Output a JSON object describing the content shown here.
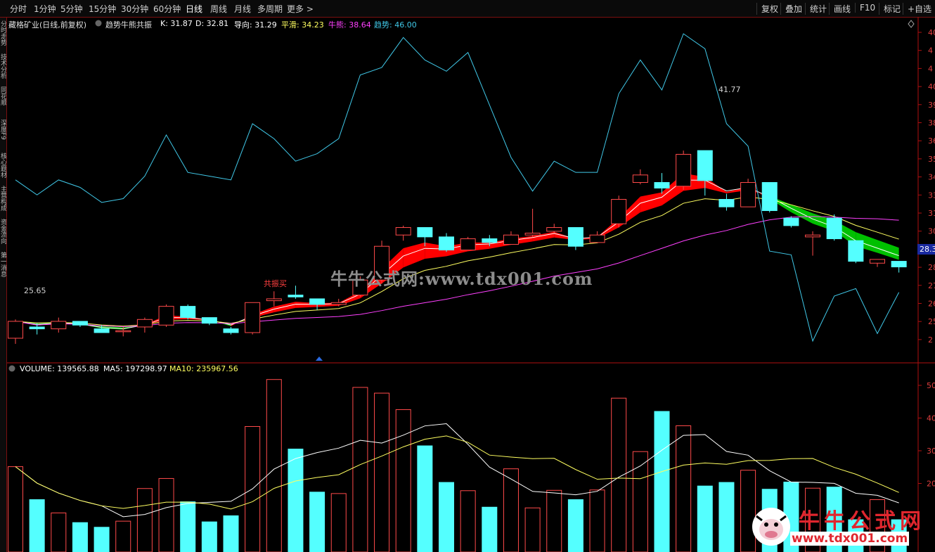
{
  "toolbar": {
    "periods": [
      "分时",
      "1分钟",
      "5分钟",
      "15分钟",
      "30分钟",
      "60分钟",
      "日线",
      "周线",
      "月线",
      "多周期",
      "更多 >"
    ],
    "active": "日线",
    "right": [
      "复权",
      "叠加",
      "统计",
      "画线",
      "F10",
      "标记",
      "+自选"
    ]
  },
  "sidebar": [
    "分时走势",
    "技术分析",
    "同花顺",
    "深度F9",
    "核心题材",
    "主营构成",
    "资金流向",
    "第一消息"
  ],
  "header": {
    "stock": "藏格矿业(日线,前复权)",
    "indicator": "趋势牛熊共振",
    "k": "K: 31.87",
    "d": "D: 32.81",
    "dx": "导向: 31.29",
    "ph": "平滑: 34.23",
    "nx": "牛熊: 38.64",
    "qs": "趋势: 46.00"
  },
  "volume_header": {
    "vol": "VOLUME: 139565.88",
    "ma5": "MA5: 197298.97",
    "ma10": "MA10: 235967.56"
  },
  "annotations": {
    "high": "41.77",
    "low": "25.65",
    "signal": "共振买"
  },
  "price_tag": "28.3",
  "axis_labels": {
    "price": [
      "40",
      "4",
      "4",
      "40",
      "39",
      "38",
      "36",
      "35",
      "34",
      "33",
      "31",
      "30",
      "29",
      "28",
      "27",
      "26",
      "25",
      "2"
    ],
    "volume": [
      "50",
      "40",
      "30",
      "20"
    ]
  },
  "watermarks": {
    "center": "牛牛公式网:www.tdx001.com",
    "logo_cn": "牛牛公式网",
    "logo_url": "www.tdx001.com"
  },
  "colors": {
    "up": "#ff4a4a",
    "down": "#54ffff",
    "ma_white": "#ffffff",
    "ma_yellow": "#ffff60",
    "ma_magenta": "#ff40ff",
    "ma_cyan": "#40c8e8",
    "band_red": "#ff0000",
    "band_green": "#00c000",
    "axis": "#b01010"
  },
  "chart_data": {
    "type": "candlestick",
    "candles": [
      {
        "o": 25.7,
        "h": 26.7,
        "l": 25.4,
        "c": 26.6
      },
      {
        "o": 26.3,
        "h": 26.5,
        "l": 25.9,
        "c": 26.2
      },
      {
        "o": 26.2,
        "h": 26.8,
        "l": 26.0,
        "c": 26.6
      },
      {
        "o": 26.6,
        "h": 26.6,
        "l": 26.3,
        "c": 26.4
      },
      {
        "o": 26.2,
        "h": 26.4,
        "l": 26.0,
        "c": 26.0
      },
      {
        "o": 26.1,
        "h": 26.3,
        "l": 25.8,
        "c": 26.1
      },
      {
        "o": 26.3,
        "h": 26.8,
        "l": 26.0,
        "c": 26.7
      },
      {
        "o": 26.4,
        "h": 27.5,
        "l": 26.3,
        "c": 27.4
      },
      {
        "o": 27.4,
        "h": 27.5,
        "l": 26.7,
        "c": 26.8
      },
      {
        "o": 26.8,
        "h": 26.8,
        "l": 26.4,
        "c": 26.5
      },
      {
        "o": 26.2,
        "h": 26.3,
        "l": 25.9,
        "c": 26.0
      },
      {
        "o": 26.0,
        "h": 27.6,
        "l": 25.9,
        "c": 27.6
      },
      {
        "o": 27.7,
        "h": 28.2,
        "l": 27.4,
        "c": 27.8
      },
      {
        "o": 28.0,
        "h": 28.5,
        "l": 27.8,
        "c": 27.9
      },
      {
        "o": 27.8,
        "h": 27.8,
        "l": 27.2,
        "c": 27.5
      },
      {
        "o": 27.5,
        "h": 27.8,
        "l": 27.4,
        "c": 27.6
      },
      {
        "o": 28.0,
        "h": 29.0,
        "l": 27.9,
        "c": 28.8
      },
      {
        "o": 28.8,
        "h": 30.9,
        "l": 28.6,
        "c": 30.6
      },
      {
        "o": 31.2,
        "h": 31.7,
        "l": 30.9,
        "c": 31.6
      },
      {
        "o": 31.6,
        "h": 31.6,
        "l": 30.6,
        "c": 31.1
      },
      {
        "o": 31.1,
        "h": 31.3,
        "l": 30.3,
        "c": 30.4
      },
      {
        "o": 30.4,
        "h": 31.1,
        "l": 30.4,
        "c": 31.0
      },
      {
        "o": 31.0,
        "h": 31.2,
        "l": 30.6,
        "c": 30.8
      },
      {
        "o": 30.7,
        "h": 31.4,
        "l": 30.7,
        "c": 31.2
      },
      {
        "o": 31.2,
        "h": 32.6,
        "l": 31.1,
        "c": 31.3
      },
      {
        "o": 31.4,
        "h": 31.8,
        "l": 31.3,
        "c": 31.6
      },
      {
        "o": 31.6,
        "h": 31.6,
        "l": 30.4,
        "c": 30.6
      },
      {
        "o": 30.8,
        "h": 31.4,
        "l": 30.8,
        "c": 31.2
      },
      {
        "o": 31.8,
        "h": 33.3,
        "l": 31.6,
        "c": 33.1
      },
      {
        "o": 34.0,
        "h": 34.7,
        "l": 33.9,
        "c": 34.4
      },
      {
        "o": 34.0,
        "h": 34.5,
        "l": 33.4,
        "c": 33.7
      },
      {
        "o": 33.8,
        "h": 35.7,
        "l": 33.6,
        "c": 35.5
      },
      {
        "o": 35.7,
        "h": 35.7,
        "l": 33.3,
        "c": 34.1
      },
      {
        "o": 33.1,
        "h": 33.4,
        "l": 32.5,
        "c": 32.7
      },
      {
        "o": 32.7,
        "h": 34.2,
        "l": 32.7,
        "c": 34.0
      },
      {
        "o": 34.0,
        "h": 34.0,
        "l": 32.4,
        "c": 32.5
      },
      {
        "o": 32.1,
        "h": 32.2,
        "l": 31.6,
        "c": 31.7
      },
      {
        "o": 31.1,
        "h": 31.4,
        "l": 30.1,
        "c": 31.2
      },
      {
        "o": 32.1,
        "h": 32.3,
        "l": 30.9,
        "c": 31.0
      },
      {
        "o": 30.9,
        "h": 30.9,
        "l": 29.7,
        "c": 29.8
      },
      {
        "o": 29.7,
        "h": 29.9,
        "l": 29.5,
        "c": 29.9
      },
      {
        "o": 29.8,
        "h": 29.8,
        "l": 29.2,
        "c": 29.5
      }
    ],
    "volume": [
      28.8,
      19.6,
      15.9,
      13.2,
      11.9,
      13.6,
      22.7,
      25.5,
      19.0,
      13.4,
      15.1,
      40.0,
      53.1,
      33.7,
      21.7,
      21.3,
      50.9,
      49.3,
      44.7,
      34.6,
      24.4,
      22.1,
      17.5,
      28.2,
      17.3,
      22.2,
      19.6,
      22.3,
      47.9,
      33.0,
      44.2,
      40.2,
      23.4,
      24.4,
      27.8,
      22.5,
      24.5,
      22.8,
      23.1,
      14.0,
      19.6,
      14.0
    ],
    "price_axis": {
      "min": 24.8,
      "max": 42.3
    },
    "volume_axis": {
      "min": 5,
      "max": 55
    }
  }
}
